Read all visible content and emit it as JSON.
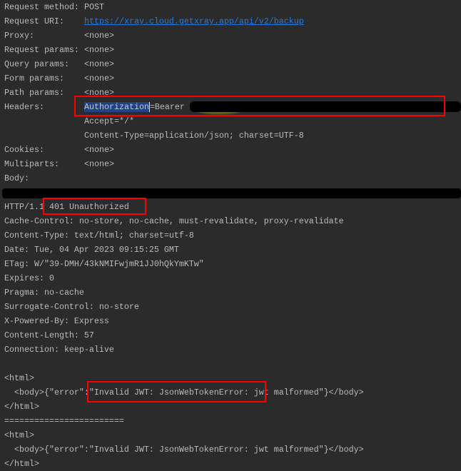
{
  "request": {
    "fields": [
      {
        "label": "Request method:",
        "value": "POST"
      },
      {
        "label": "Request URI:",
        "value": "https://xray.cloud.getxray.app/api/v2/backup",
        "link": true
      },
      {
        "label": "Proxy:",
        "value": "<none>"
      },
      {
        "label": "Request params:",
        "value": "<none>"
      },
      {
        "label": "Query params:",
        "value": "<none>"
      },
      {
        "label": "Form params:",
        "value": "<none>"
      },
      {
        "label": "Path params:",
        "value": "<none>"
      }
    ],
    "headers_label": "Headers:",
    "auth_key": "Authorization",
    "auth_value": "=Bearer",
    "header_accept": "Accept=*/*",
    "header_content_type": "Content-Type=application/json; charset=UTF-8",
    "cookies_label": "Cookies:",
    "cookies_value": "<none>",
    "multiparts_label": "Multiparts:",
    "multiparts_value": "<none>",
    "body_label": "Body:"
  },
  "response": {
    "protocol": "HTTP/1.1",
    "status": "401 Unauthorized",
    "headers": [
      "Cache-Control: no-store, no-cache, must-revalidate, proxy-revalidate",
      "Content-Type: text/html; charset=utf-8",
      "Date: Tue, 04 Apr 2023 09:15:25 GMT",
      "ETag: W/\"39-DMH/43kNMIFwjmR1JJ0hQkYmKTw\"",
      "Expires: 0",
      "Pragma: no-cache",
      "Surrogate-Control: no-store",
      "X-Powered-By: Express",
      "Content-Length: 57",
      "Connection: keep-alive"
    ],
    "html_open": "<html>",
    "body_prefix": "  <body>{\"error\":",
    "error_message": "\"Invalid JWT: JsonWebTokenError: jwt malformed\"",
    "body_suffix": "}</body>",
    "html_close": "</html>",
    "separator": "========================",
    "html_open_2": "<html>",
    "body_line_2": "  <body>{\"error\":\"Invalid JWT: JsonWebTokenError: jwt malformed\"}</body>",
    "html_close_2": "</html>"
  }
}
